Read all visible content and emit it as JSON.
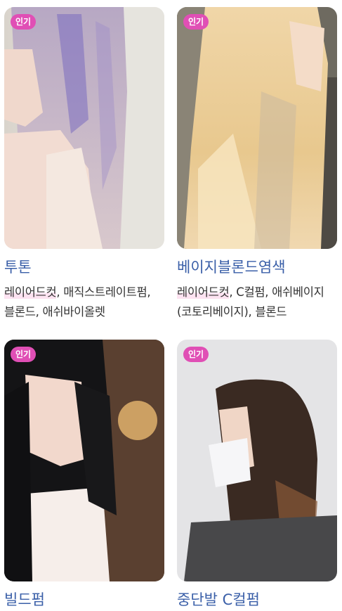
{
  "badge_label": "인기",
  "cards": [
    {
      "title": "투톤",
      "tag_first": "레이어드컷",
      "tag_rest": ", 매직스트레이트펌, 블론드, 애쉬바이올렛"
    },
    {
      "title": "베이지블론드염색",
      "tag_first": "레이어드컷",
      "tag_rest": ", C컬펌, 애쉬베이지(코토리베이지), 블론드"
    },
    {
      "title": "빌드펌",
      "tag_first": "",
      "tag_rest": ""
    },
    {
      "title": "중단발 C컬펌",
      "tag_first": "",
      "tag_rest": ""
    }
  ],
  "colors": {
    "badge": "#e04fb5",
    "title": "#3a5fa8",
    "tag_highlight": "#fde3f1"
  }
}
